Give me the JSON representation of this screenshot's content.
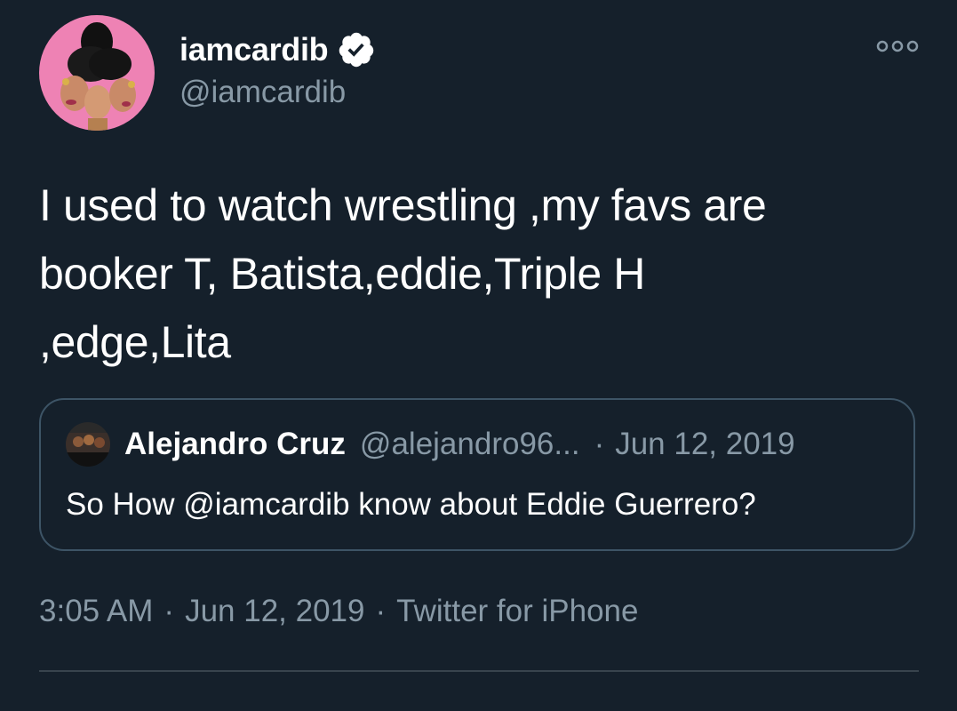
{
  "tweet": {
    "author": {
      "display_name": "iamcardib",
      "handle": "@iamcardib",
      "verified": true,
      "avatar_icon": "profile-avatar"
    },
    "more_icon": "more-options-icon",
    "text_lines": [
      "I used to watch wrestling ,my favs are",
      "booker T, Batista,eddie,Triple H",
      ",edge,Lita"
    ],
    "quoted": {
      "display_name": "Alejandro Cruz",
      "handle": "@alejandro96...",
      "separator": "·",
      "date": "Jun 12, 2019",
      "text": "So How @iamcardib know about Eddie Guerrero?"
    },
    "meta": {
      "time": "3:05 AM",
      "date": "Jun 12, 2019",
      "source": "Twitter for iPhone",
      "separator": "·"
    }
  },
  "colors": {
    "background": "#15202b",
    "primary_text": "#ffffff",
    "secondary_text": "#8899a6",
    "border": "#3d5466",
    "divider": "#38444d",
    "avatar_bg": "#ee82b4"
  }
}
